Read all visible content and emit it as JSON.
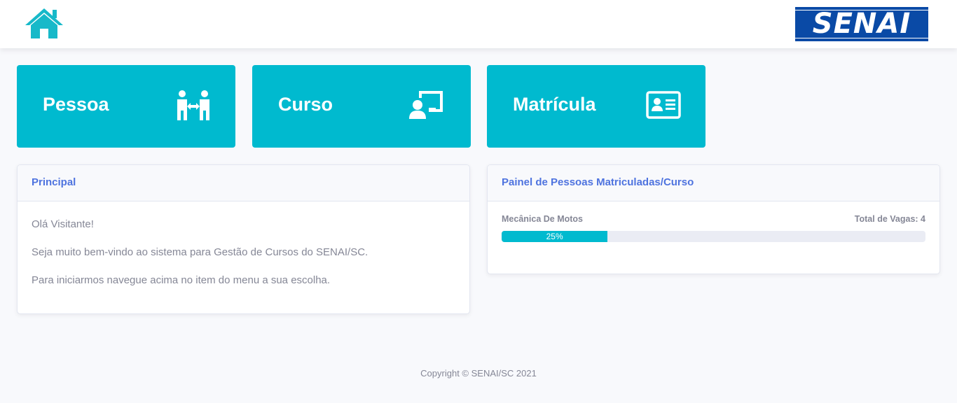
{
  "header": {
    "home_icon": "home-icon",
    "logo_text": "SENAI",
    "brand_color": "#0a4aa6"
  },
  "nav_cards": [
    {
      "label": "Pessoa",
      "icon": "people-exchange-icon"
    },
    {
      "label": "Curso",
      "icon": "teacher-board-icon"
    },
    {
      "label": "Matrícula",
      "icon": "id-card-icon"
    }
  ],
  "accent_color": "#00bacf",
  "principal": {
    "title": "Principal",
    "lines": [
      "Olá Visitante!",
      "Seja muito bem-vindo ao sistema para Gestão de Cursos do SENAI/SC.",
      "Para iniciarmos navegue acima no item do menu a sua escolha."
    ]
  },
  "enrollment_panel": {
    "title": "Painel de Pessoas Matriculadas/Curso",
    "courses": [
      {
        "name": "Mecânica De Motos",
        "total_label": "Total de Vagas: 4",
        "progress": 0.25,
        "progress_label": "25%"
      }
    ]
  },
  "footer": {
    "text": "Copyright © SENAI/SC 2021"
  }
}
